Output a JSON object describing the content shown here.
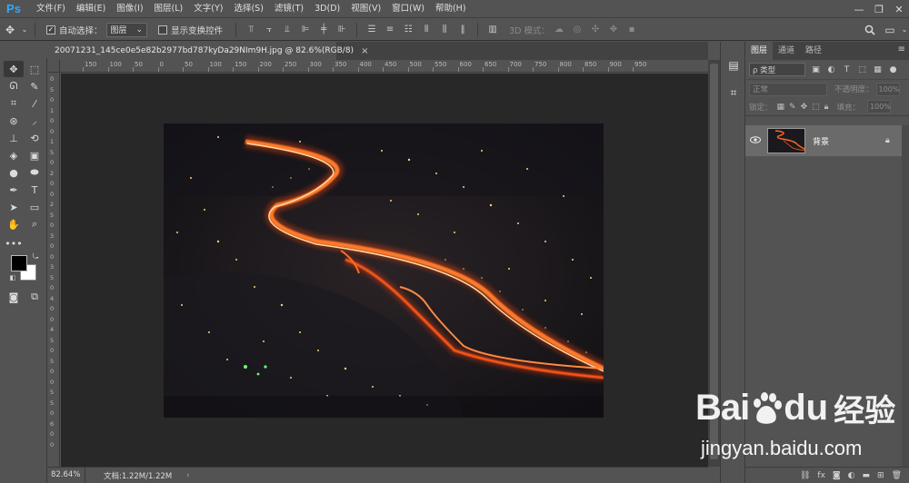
{
  "app": {
    "logo": "Ps"
  },
  "menu": [
    "文件(F)",
    "编辑(E)",
    "图像(I)",
    "图层(L)",
    "文字(Y)",
    "选择(S)",
    "滤镜(T)",
    "3D(D)",
    "视图(V)",
    "窗口(W)",
    "帮助(H)"
  ],
  "window_controls": {
    "minimize": "—",
    "restore": "❐",
    "close": "✕"
  },
  "options": {
    "auto_select_label": "自动选择：",
    "auto_select_checked": true,
    "auto_select_value": "图层",
    "show_transform_label": "显示变换控件",
    "show_transform_checked": false,
    "mode_3d_label": "3D 模式："
  },
  "document": {
    "tab_title": "20071231_145ce0e5e82b2977bd787kyDa29NIm9H.jpg @ 82.6%(RGB/8)",
    "close": "×"
  },
  "ruler": {
    "h_labels": [
      "150",
      "100",
      "50",
      "0",
      "50",
      "100",
      "150",
      "200",
      "250",
      "300",
      "350",
      "400",
      "450",
      "500",
      "550",
      "600",
      "650",
      "700",
      "750",
      "800",
      "850",
      "900",
      "950"
    ],
    "v_labels": [
      "0",
      "5",
      "0",
      "1",
      "0",
      "0",
      "1",
      "5",
      "0",
      "2",
      "0",
      "0",
      "2",
      "5",
      "0",
      "3",
      "0",
      "0",
      "3",
      "5",
      "0",
      "4",
      "0",
      "0",
      "4",
      "5",
      "0",
      "5",
      "0",
      "0",
      "5",
      "5",
      "0",
      "6",
      "0",
      "0"
    ]
  },
  "status": {
    "zoom": "82.64%",
    "doc": "文档:1.22M/1.22M",
    "arrow": "›"
  },
  "layers_panel": {
    "tabs": [
      "图层",
      "通道",
      "路径"
    ],
    "active_tab": 0,
    "filter_placeholder": "ρ 类型",
    "blend_mode": "正常",
    "opacity_label": "不透明度：",
    "opacity_value": "100%",
    "lock_label": "锁定：",
    "fill_label": "填充：",
    "fill_value": "100%",
    "layers": [
      {
        "name": "背景",
        "visible": true,
        "locked": true
      }
    ]
  },
  "watermark": {
    "bai": "Bai",
    "du": "du",
    "cn": "经验",
    "url": "jingyan.baidu.com"
  }
}
